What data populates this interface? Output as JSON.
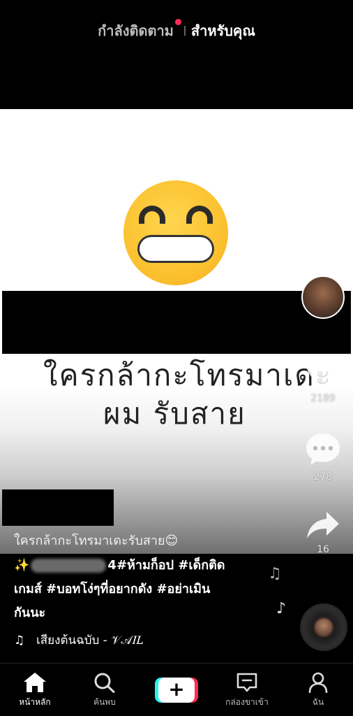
{
  "tabs": {
    "following": "กำลังติดตาม",
    "for_you": "สำหรับคุณ"
  },
  "video": {
    "overlay_line1": "ใครกล้ากะโทรมาเดะ",
    "overlay_line2": "ผม รับสาย"
  },
  "actions": {
    "likes": "2189",
    "comments": "278",
    "shares": "16"
  },
  "caption": {
    "title": "ใครกล้ากะโทรมาเดะรับสาย😊",
    "tags_prefix": "✨",
    "tags_line1": "4#ห้ามก็อป #เด็กติด",
    "tags_line2": "เกมส์ #บอทโง่ๆที่อยากดัง #อย่าเมิน",
    "tags_line3": "กันนะ"
  },
  "sound": {
    "icon": "♫",
    "text": "เสียงต้นฉบับ - 𝒱𝒜𝐼𝐿"
  },
  "nav": {
    "home": "หน้าหลัก",
    "discover": "ค้นพบ",
    "inbox": "กล่องขาเข้า",
    "me": "ฉัน"
  },
  "colors": {
    "accent_red": "#fe2c55",
    "accent_cyan": "#25f4ee",
    "background": "#000000"
  }
}
